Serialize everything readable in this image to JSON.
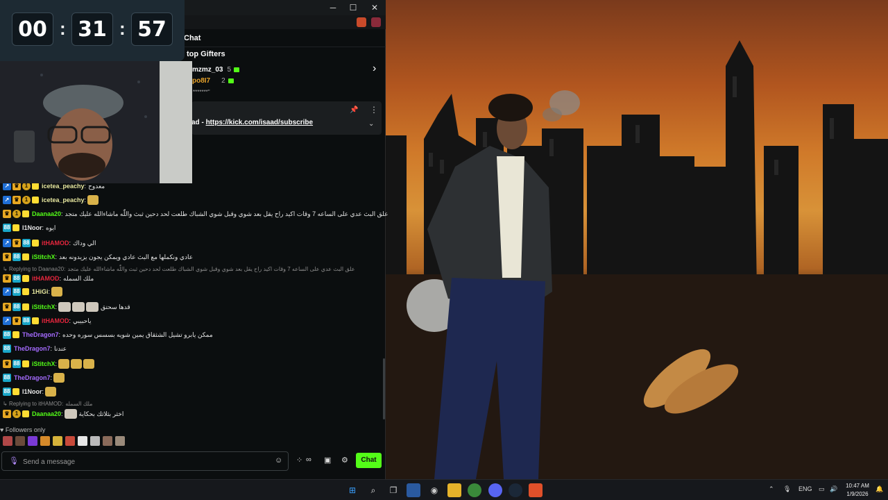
{
  "window": {
    "minimize": "─",
    "maximize": "☐",
    "close": "✕"
  },
  "chat": {
    "title": "Chat"
  },
  "gifters": {
    "title": "top Gifters",
    "items": [
      {
        "name": "mzmz_03",
        "count": "5",
        "color": "#ffffff"
      },
      {
        "name": "po8I7",
        "count": "2",
        "color": "#e8a32b"
      }
    ],
    "partial_text": "*******\""
  },
  "pinned": {
    "prefix": "ad - ",
    "link": "https://kick.com/isaad/subscribe"
  },
  "timer": {
    "hours": "00",
    "minutes": "31",
    "seconds": "57",
    "sep": ":"
  },
  "messages": [
    {
      "user": "icetea_peachy",
      "color": "#e8e8a0",
      "text": "معدوح",
      "badges": [
        "mod",
        "vip",
        "coin",
        "sub"
      ]
    },
    {
      "user": "icetea_peachy",
      "color": "#e8e8a0",
      "text": "",
      "badges": [
        "mod",
        "vip",
        "coin",
        "sub"
      ],
      "emote": "hand"
    },
    {
      "user": "Daanaa20",
      "color": "#53fc18",
      "text": "علق البث عدي على الساعه 7 وقات اكيد راح يقل بعد شوي وقبل شوي الشباك طلعت لحد دحين ثبث واللّٰه ماشاءالله عليك متجد",
      "badges": [
        "vip",
        "coin",
        "sub"
      ]
    },
    {
      "user": "I1Noor",
      "color": "#e8e8e8",
      "text": "ايوه",
      "badges": [
        "og",
        "sub"
      ]
    },
    {
      "user": "itHAMOD",
      "color": "#e5263d",
      "text": "الي وداك",
      "badges": [
        "mod",
        "vip",
        "og",
        "sub"
      ]
    },
    {
      "user": "iStitchX",
      "color": "#53fc18",
      "text": "عادي ونكملها مع البث عادي ويمكن يجون يزيدونه بعد",
      "badges": [
        "vip",
        "og",
        "sub"
      ]
    },
    {
      "reply_label": "Replying to Daanaa20:",
      "reply_text": "علق البث عدي على الساعه 7 وقات اكيد راح يقل بعد شوي وقبل شوي الشباك طلعت لحد دحين ثبث واللّٰه ماشاءالله عليك متجد"
    },
    {
      "user": "itHAMOD",
      "color": "#e5263d",
      "text": "",
      "badges": [
        "vip",
        "og",
        "sub"
      ],
      "inline_prefix": "ملك السمله"
    },
    {
      "user": "1HiGi",
      "color": "#e8e8a0",
      "text": "",
      "badges": [
        "mod",
        "og",
        "sub"
      ],
      "emote": "1"
    },
    {
      "user": "iStitchX",
      "color": "#53fc18",
      "text": "قدها سحتق",
      "badges": [
        "vip",
        "og",
        "sub"
      ],
      "emote": "3"
    },
    {
      "user": "itHAMOD",
      "color": "#e5263d",
      "text": "ياحبيبي",
      "badges": [
        "mod",
        "vip",
        "og",
        "sub"
      ]
    },
    {
      "user": "TheDragon7",
      "color": "#a56bff",
      "text": "ممكن يابرو تشيل الشثقاق يمين شويه بسسس سوره وحده",
      "badges": [
        "og",
        "sub"
      ]
    },
    {
      "user": "TheDragon7",
      "color": "#a56bff",
      "text": "عندنا",
      "badges": [
        "og"
      ]
    },
    {
      "user": "iStitchX",
      "color": "#53fc18",
      "text": "",
      "badges": [
        "vip",
        "og",
        "sub"
      ],
      "emote": "3"
    },
    {
      "user": "TheDragon7",
      "color": "#a56bff",
      "text": "",
      "badges": [
        "og"
      ],
      "emote": "1"
    },
    {
      "user": "I1Noor",
      "color": "#e8e8e8",
      "text": "",
      "badges": [
        "og",
        "sub"
      ],
      "emote": "1"
    },
    {
      "reply_label": "Replying to itHAMOD:",
      "reply_text": "ملك السمله"
    },
    {
      "user": "Daanaa20",
      "color": "#53fc18",
      "text": "اخثر بثلاثك بحكاية",
      "badges": [
        "vip",
        "coin",
        "sub"
      ],
      "emote": "1"
    }
  ],
  "labels": {
    "followers": "Followers only",
    "input_placeholder": "Send a message",
    "send": "Chat"
  },
  "taskbar": {
    "lang": "ENG",
    "time": "10:47 AM",
    "date": "1/9/2026"
  },
  "colors": {
    "kick_green": "#53fc18",
    "accent_purple": "#a56bff"
  }
}
